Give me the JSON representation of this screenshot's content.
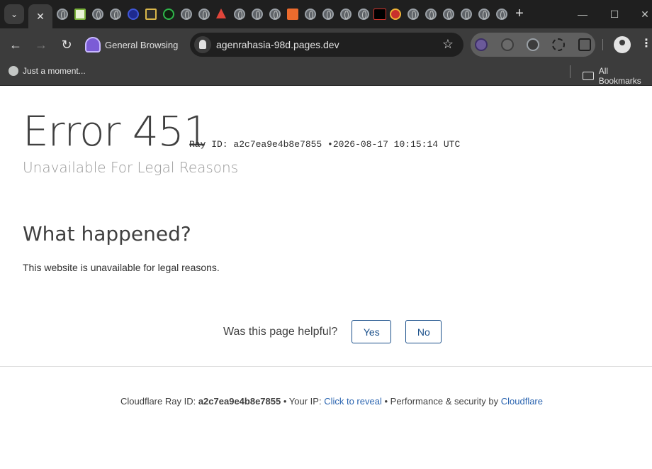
{
  "browser": {
    "active_tab_close": "✕",
    "tab_search": "⌄",
    "new_tab": "+",
    "window_controls": {
      "minimize": "—",
      "maximize": "☐",
      "close": "✕"
    },
    "profile_name": "General Browsing",
    "url": "agenrahasia-98d.pages.dev",
    "bookmarks": [
      {
        "label": "Just a moment..."
      }
    ],
    "all_bookmarks_label": "All Bookmarks"
  },
  "page": {
    "error_title": "Error 451",
    "ray_id_label": "Ray ID: a2c7ea9e4b8e7855",
    "bullet": "•",
    "timestamp": "2026-08-17 10:15:14 UTC",
    "subtitle": "Unavailable For Legal Reasons",
    "what_happened_heading": "What happened?",
    "what_happened_body": "This website is unavailable for legal reasons.",
    "feedback": {
      "question": "Was this page helpful?",
      "yes_label": "Yes",
      "no_label": "No"
    },
    "footer": {
      "ray_prefix": "Cloudflare Ray ID:",
      "ray_id": "a2c7ea9e4b8e7855",
      "separator": "•",
      "ip_prefix": "Your IP:",
      "ip_link": "Click to reveal",
      "perf_prefix": "Performance & security by",
      "cloudflare_link": "Cloudflare"
    }
  },
  "colors": {
    "link": "#2a64b0",
    "button_border": "#1a4f8a",
    "heading": "#404040",
    "subtitle": "#999999",
    "chrome_dark": "#1f1f1f",
    "chrome_toolbar": "#3c3c3c"
  }
}
